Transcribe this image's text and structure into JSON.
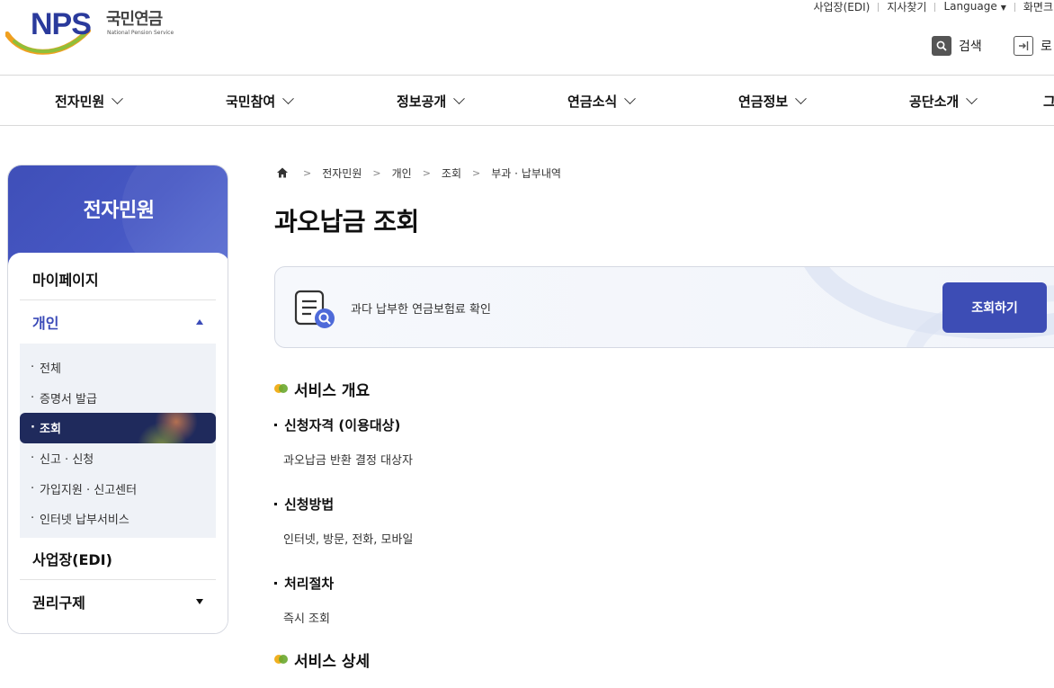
{
  "logo": {
    "brand": "NPS",
    "name_ko": "국민연금",
    "name_en": "National Pension Service"
  },
  "utility": {
    "edi": "사업장(EDI)",
    "branch": "지사찾기",
    "language": "Language",
    "screen": "화면크"
  },
  "header_buttons": {
    "search": "검색",
    "login": "로"
  },
  "gnb": [
    "전자민원",
    "국민참여",
    "정보공개",
    "연금소식",
    "연금정보",
    "공단소개",
    "그"
  ],
  "sidebar": {
    "title": "전자민원",
    "items": [
      {
        "label": "마이페이지"
      },
      {
        "label": "개인",
        "expanded": true
      },
      {
        "label": "사업장(EDI)"
      },
      {
        "label": "권리구제"
      }
    ],
    "sub_items": [
      {
        "label": "전체"
      },
      {
        "label": "증명서 발급"
      },
      {
        "label": "조회",
        "active": true
      },
      {
        "label": "신고 · 신청"
      },
      {
        "label": "가입지원 · 신고센터"
      },
      {
        "label": "인터넷 납부서비스"
      }
    ]
  },
  "breadcrumb": [
    "전자민원",
    "개인",
    "조회",
    "부과 · 납부내역"
  ],
  "page_title": "과오납금 조회",
  "service_box": {
    "text": "과다 납부한 연금보험료 확인",
    "button": "조회하기"
  },
  "sections": {
    "overview_title": "서비스 개요",
    "eligibility_title": "신청자격 (이용대상)",
    "eligibility_text": "과오납금 반환 결정 대상자",
    "method_title": "신청방법",
    "method_text": "인터넷, 방문, 전화, 모바일",
    "process_title": "처리절차",
    "process_text": "즉시 조회",
    "detail_title": "서비스 상세"
  },
  "colors": {
    "primary": "#3d4db5",
    "sidebar_active": "#1f2a5c",
    "logo_blue": "#2a3a9c"
  }
}
